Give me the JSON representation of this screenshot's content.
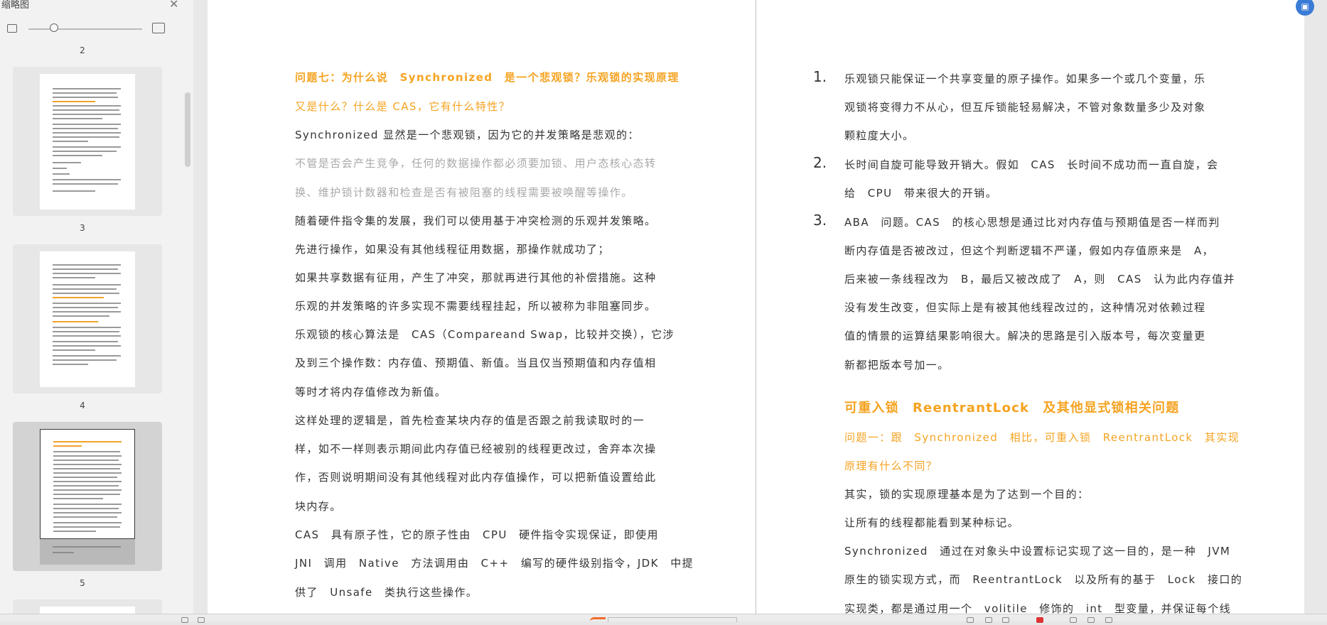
{
  "sidebar": {
    "title": "缩略图",
    "pages": [
      {
        "label": "2"
      },
      {
        "label": "3"
      },
      {
        "label": "4"
      },
      {
        "label": "5"
      }
    ]
  },
  "left_page": {
    "q7_title_1": "问题七：为什么说　Synchronized　是一个悲观锁？乐观锁的实现原理",
    "q7_title_2": "又是什么？什么是 CAS，它有什么特性？",
    "p1": "Synchronized 显然是一个悲观锁，因为它的并发策略是悲观的：",
    "p2a": "不管是否会产生竞争，任何的数据操作都必须要加锁、用户态核心态转",
    "p2b": "换、维护锁计数器和检查是否有被阻塞的线程需要被唤醒等操作。",
    "p3": "随着硬件指令集的发展，我们可以使用基于冲突检测的乐观并发策略。",
    "p4": "先进行操作，如果没有其他线程征用数据，那操作就成功了；",
    "p5a": "如果共享数据有征用，产生了冲突，那就再进行其他的补偿措施。这种",
    "p5b": "乐观的并发策略的许多实现不需要线程挂起，所以被称为非阻塞同步。",
    "p6a": "乐观锁的核心算法是　CAS（Compareand Swap，比较并交换），它涉",
    "p6b": "及到三个操作数：内存值、预期值、新值。当且仅当预期值和内存值相",
    "p6c": "等时才将内存值修改为新值。",
    "p7a": "这样处理的逻辑是，首先检查某块内存的值是否跟之前我读取时的一",
    "p7b": "样，如不一样则表示期间此内存值已经被别的线程更改过，舍弃本次操",
    "p7c": "作，否则说明期间没有其他线程对此内存值操作，可以把新值设置给此",
    "p7d": "块内存。",
    "p8a": "CAS　具有原子性，它的原子性由　CPU　硬件指令实现保证，即使用",
    "p8b": "JNI　调用　Native　方法调用由　C++　编写的硬件级别指令，JDK　中提",
    "p8c": "供了　Unsafe　类执行这些操作。"
  },
  "right_page": {
    "items": [
      {
        "num": "1.",
        "lines": [
          "乐观锁只能保证一个共享变量的原子操作。如果多一个或几个变量，乐",
          "观锁将变得力不从心，但互斥锁能轻易解决，不管对象数量多少及对象",
          "颗粒度大小。"
        ]
      },
      {
        "num": "2.",
        "lines": [
          "长时间自旋可能导致开销大。假如　CAS　长时间不成功而一直自旋，会",
          "给　CPU　带来很大的开销。"
        ]
      },
      {
        "num": "3.",
        "lines": [
          "ABA　问题。CAS　的核心思想是通过比对内存值与预期值是否一样而判",
          "断内存值是否被改过，但这个判断逻辑不严谨，假如内存值原来是　A，",
          "后来被一条线程改为　B，最后又被改成了　A，则　CAS　认为此内存值并",
          "没有发生改变，但实际上是有被其他线程改过的，这种情况对依赖过程",
          "值的情景的运算结果影响很大。解决的思路是引入版本号，每次变量更",
          "新都把版本号加一。"
        ]
      }
    ],
    "section_heading": "可重入锁　ReentrantLock　及其他显式锁相关问题",
    "q1_title_1": "问题一：跟　Synchronized　相比，可重入锁　ReentrantLock　其实现",
    "q1_title_2": "原理有什么不同？",
    "r1": "其实，锁的实现原理基本是为了达到一个目的：",
    "r2": "让所有的线程都能看到某种标记。",
    "r3a": "Synchronized　通过在对象头中设置标记实现了这一目的，是一种　JVM",
    "r3b": "原生的锁实现方式，而　ReentrantLock　以及所有的基于　Lock　接口的",
    "r3c": "实现类，都是通过用一个　volitile　修饰的　int　型变量，并保证每个线"
  },
  "colors": {
    "accent": "#f5a321",
    "float_button": "#3a7bd5"
  }
}
